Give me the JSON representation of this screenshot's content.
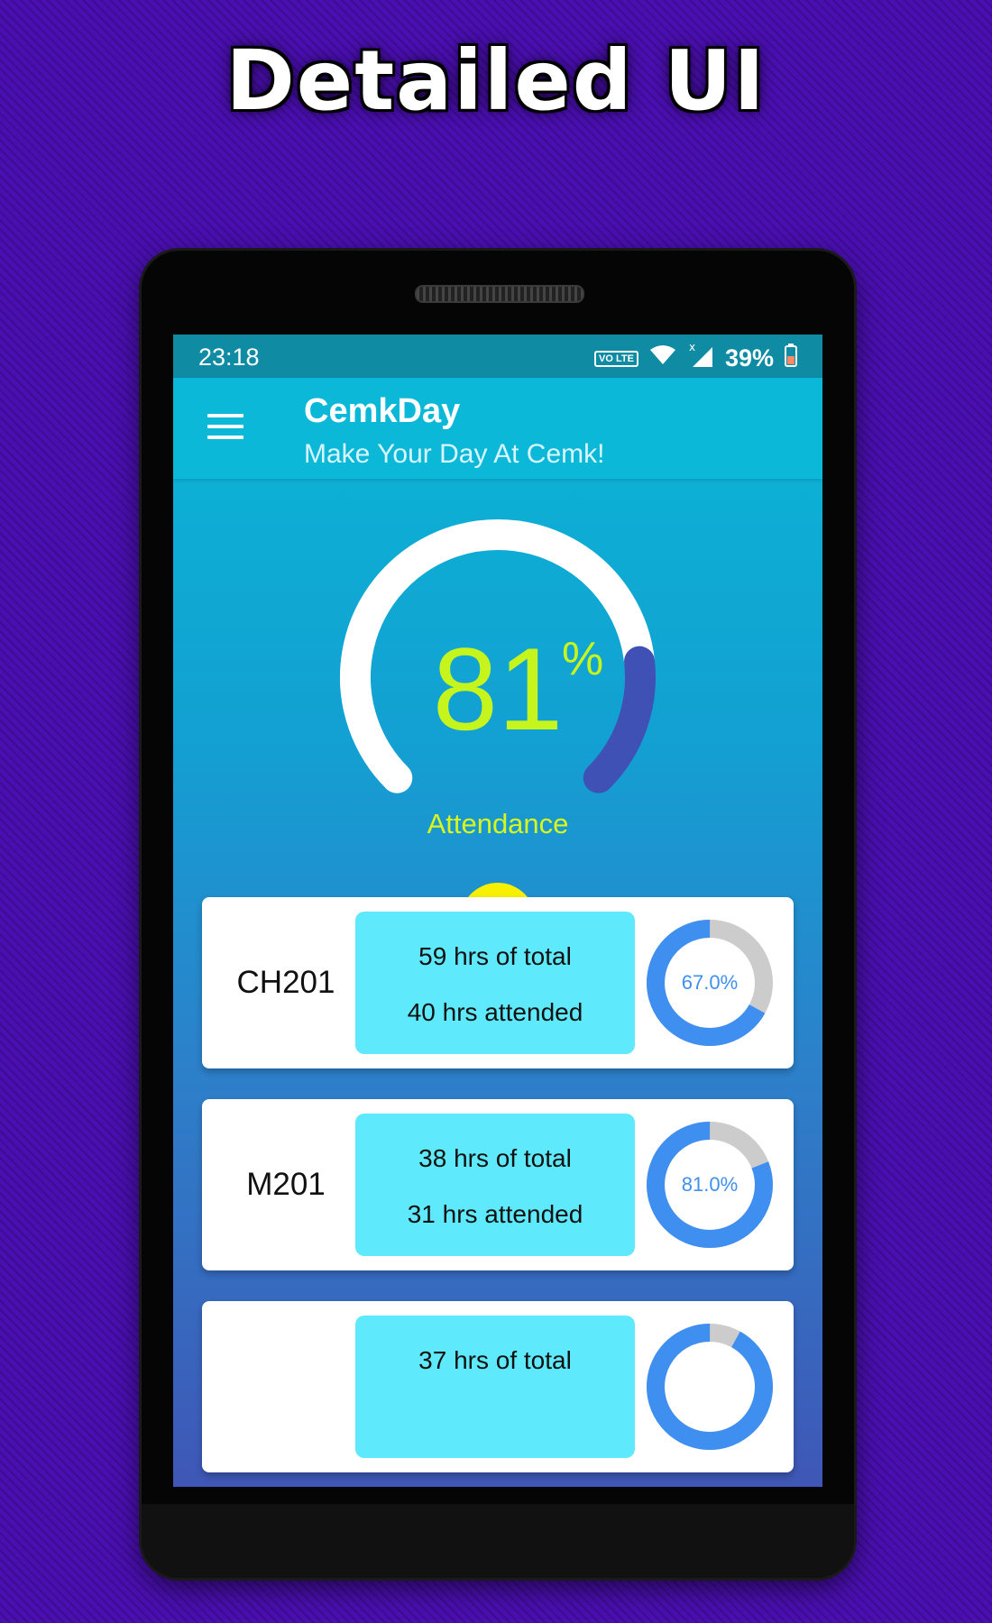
{
  "promo": {
    "title": "Detailed UI"
  },
  "status_bar": {
    "time": "23:18",
    "volte": "VO LTE",
    "battery": "39%"
  },
  "appbar": {
    "title": "CemkDay",
    "subtitle": "Make Your Day At Cemk!"
  },
  "gauge": {
    "value": "81",
    "unit": "%",
    "label": "Attendance",
    "fraction": 0.81
  },
  "warning": {
    "symbol": "!"
  },
  "courses": [
    {
      "code": "CH201",
      "total": "59 hrs of total",
      "attended": "40 hrs attended",
      "percent_label": "67.0%",
      "percent": 67.0
    },
    {
      "code": "M201",
      "total": "38 hrs of total",
      "attended": "31 hrs attended",
      "percent_label": "81.0%",
      "percent": 81.0
    },
    {
      "code": "",
      "total": "37 hrs of total",
      "attended": "",
      "percent_label": "",
      "percent": 92.0
    }
  ],
  "colors": {
    "accent_green": "#c6f51e",
    "gauge_track": "#ffffff",
    "gauge_fill": "#3f51b5",
    "donut_fill": "#3f8ff0",
    "donut_rest": "#cccccc",
    "hours_box": "#5eeafc",
    "warning": "#f7f000"
  },
  "icons": [
    "menu-icon",
    "wifi-icon",
    "signal-icon",
    "battery-icon",
    "warning-icon"
  ]
}
